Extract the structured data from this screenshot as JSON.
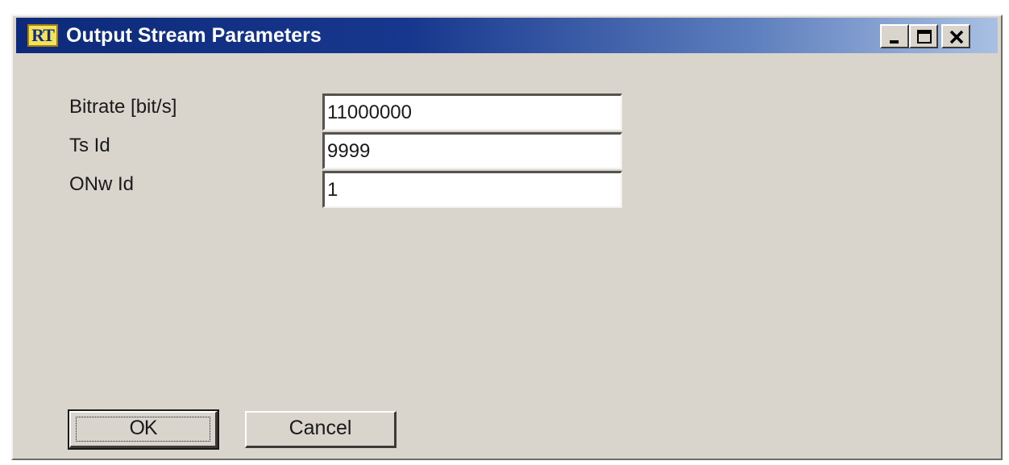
{
  "window": {
    "title": "Output Stream Parameters",
    "app_icon_text": "RT",
    "controls": {
      "minimize": "minimize-icon",
      "maximize": "maximize-icon",
      "close": "close-icon"
    }
  },
  "fields": [
    {
      "label": "Bitrate [bit/s]",
      "value": "11000000"
    },
    {
      "label": "Ts Id",
      "value": "9999"
    },
    {
      "label": "ONw Id",
      "value": "1"
    }
  ],
  "buttons": {
    "ok_label": "OK",
    "cancel_label": "Cancel"
  },
  "colors": {
    "titlebar_start": "#0d2a7a",
    "titlebar_end": "#a9c0e3",
    "window_bg": "#d9d5cd"
  }
}
